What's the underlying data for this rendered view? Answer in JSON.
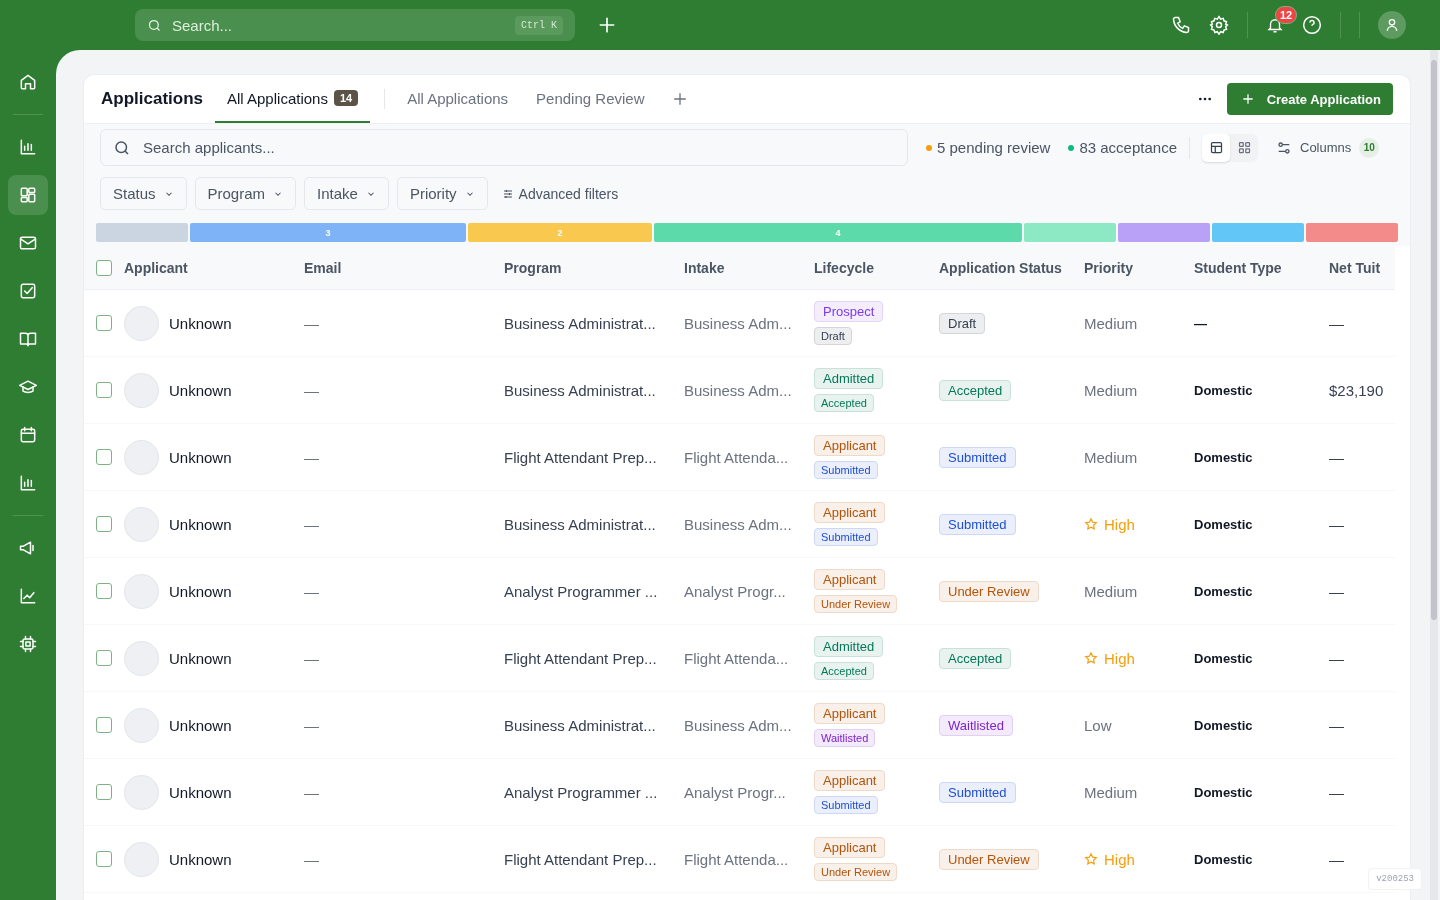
{
  "topbar": {
    "search": {
      "placeholder": "Search...",
      "shortcut": "Ctrl K"
    },
    "notifications": "12"
  },
  "sidebar": {
    "items": [
      {
        "selected": false
      },
      {
        "selected": false
      },
      {
        "selected": true
      },
      {
        "selected": false
      },
      {
        "selected": false
      },
      {
        "selected": false
      },
      {
        "selected": false
      },
      {
        "selected": false
      },
      {
        "selected": false
      },
      {
        "selected": false
      },
      {
        "selected": false
      },
      {
        "selected": false
      }
    ]
  },
  "page": {
    "title": "Applications",
    "tabs": [
      {
        "label": "All Applications",
        "count": "14",
        "selected": true
      },
      {
        "label": "All Applications",
        "selected": false
      },
      {
        "label": "Pending Review",
        "selected": false
      }
    ],
    "create_button": "Create Application"
  },
  "toolbar": {
    "search": {
      "placeholder": "Search applicants..."
    },
    "stats": [
      {
        "text": "5 pending review",
        "color": "#f59e0b"
      },
      {
        "text": "83 acceptance",
        "color": "#10b981"
      }
    ],
    "views": [
      {
        "selected": true
      },
      {
        "selected": false
      }
    ],
    "columns_button": "Columns",
    "columns_count": "10"
  },
  "filters": [
    {
      "label": "Status"
    },
    {
      "label": "Program"
    },
    {
      "label": "Intake"
    },
    {
      "label": "Priority"
    }
  ],
  "advanced_filters": "Advanced filters",
  "distribution": [
    {
      "color": "#cbd5e1"
    },
    {
      "color": "#7eb3f7",
      "label": "3"
    },
    {
      "color": "#f9c84f",
      "label": "2"
    },
    {
      "color": "#5cdaa9",
      "label": "4"
    },
    {
      "color": "#8ce9c4"
    },
    {
      "color": "#b8a1f7"
    },
    {
      "color": "#62c6f6"
    },
    {
      "color": "#f48b8b"
    }
  ],
  "table": {
    "select_all": {
      "checked": false
    },
    "columns": [
      "Applicant",
      "Email",
      "Program",
      "Intake",
      "Lifecycle",
      "Application Status",
      "Priority",
      "Student Type",
      "Net Tuit"
    ],
    "rows": [
      {
        "checked": false,
        "applicant": "Unknown",
        "email": "—",
        "program": "Business Administrat...",
        "intake": "Business Adm...",
        "lifecycle": {
          "text": "Prospect",
          "color": "#7c3aed"
        },
        "stage": {
          "text": "Draft",
          "color": "#374151"
        },
        "status": {
          "text": "Draft",
          "color": "#374151"
        },
        "priority": {
          "text": "Medium",
          "flagged": false
        },
        "student_type": "—",
        "net_tuition": "—"
      },
      {
        "checked": false,
        "applicant": "Unknown",
        "email": "—",
        "program": "Business Administrat...",
        "intake": "Business Adm...",
        "lifecycle": {
          "text": "Admitted",
          "color": "#047857"
        },
        "stage": {
          "text": "Accepted",
          "color": "#047857"
        },
        "status": {
          "text": "Accepted",
          "color": "#047857"
        },
        "priority": {
          "text": "Medium",
          "flagged": false
        },
        "student_type": "Domestic",
        "net_tuition": "$23,190"
      },
      {
        "checked": false,
        "applicant": "Unknown",
        "email": "—",
        "program": "Flight Attendant Prep...",
        "intake": "Flight Attenda...",
        "lifecycle": {
          "text": "Applicant",
          "color": "#b45309"
        },
        "stage": {
          "text": "Submitted",
          "color": "#1d4ed8"
        },
        "status": {
          "text": "Submitted",
          "color": "#1d4ed8"
        },
        "priority": {
          "text": "Medium",
          "flagged": false
        },
        "student_type": "Domestic",
        "net_tuition": "—"
      },
      {
        "checked": false,
        "applicant": "Unknown",
        "email": "—",
        "program": "Business Administrat...",
        "intake": "Business Adm...",
        "lifecycle": {
          "text": "Applicant",
          "color": "#b45309"
        },
        "stage": {
          "text": "Submitted",
          "color": "#1d4ed8"
        },
        "status": {
          "text": "Submitted",
          "color": "#1d4ed8"
        },
        "priority": {
          "text": "High",
          "flagged": true
        },
        "student_type": "Domestic",
        "net_tuition": "—"
      },
      {
        "checked": false,
        "applicant": "Unknown",
        "email": "—",
        "program": "Analyst Programmer ...",
        "intake": "Analyst Progr...",
        "lifecycle": {
          "text": "Applicant",
          "color": "#b45309"
        },
        "stage": {
          "text": "Under Review",
          "color": "#b45309"
        },
        "status": {
          "text": "Under Review",
          "color": "#b45309"
        },
        "priority": {
          "text": "Medium",
          "flagged": false
        },
        "student_type": "Domestic",
        "net_tuition": "—"
      },
      {
        "checked": false,
        "applicant": "Unknown",
        "email": "—",
        "program": "Flight Attendant Prep...",
        "intake": "Flight Attenda...",
        "lifecycle": {
          "text": "Admitted",
          "color": "#047857"
        },
        "stage": {
          "text": "Accepted",
          "color": "#047857"
        },
        "status": {
          "text": "Accepted",
          "color": "#047857"
        },
        "priority": {
          "text": "High",
          "flagged": true
        },
        "student_type": "Domestic",
        "net_tuition": "—"
      },
      {
        "checked": false,
        "applicant": "Unknown",
        "email": "—",
        "program": "Business Administrat...",
        "intake": "Business Adm...",
        "lifecycle": {
          "text": "Applicant",
          "color": "#b45309"
        },
        "stage": {
          "text": "Waitlisted",
          "color": "#7e22ce"
        },
        "status": {
          "text": "Waitlisted",
          "color": "#7e22ce"
        },
        "priority": {
          "text": "Low",
          "flagged": false
        },
        "student_type": "Domestic",
        "net_tuition": "—"
      },
      {
        "checked": false,
        "applicant": "Unknown",
        "email": "—",
        "program": "Analyst Programmer ...",
        "intake": "Analyst Progr...",
        "lifecycle": {
          "text": "Applicant",
          "color": "#b45309"
        },
        "stage": {
          "text": "Submitted",
          "color": "#1d4ed8"
        },
        "status": {
          "text": "Submitted",
          "color": "#1d4ed8"
        },
        "priority": {
          "text": "Medium",
          "flagged": false
        },
        "student_type": "Domestic",
        "net_tuition": "—"
      },
      {
        "checked": false,
        "applicant": "Unknown",
        "email": "—",
        "program": "Flight Attendant Prep...",
        "intake": "Flight Attenda...",
        "lifecycle": {
          "text": "Applicant",
          "color": "#b45309"
        },
        "stage": {
          "text": "Under Review",
          "color": "#b45309"
        },
        "status": {
          "text": "Under Review",
          "color": "#b45309"
        },
        "priority": {
          "text": "High",
          "flagged": true
        },
        "student_type": "Domestic",
        "net_tuition": "—"
      }
    ]
  },
  "version": "v200253"
}
